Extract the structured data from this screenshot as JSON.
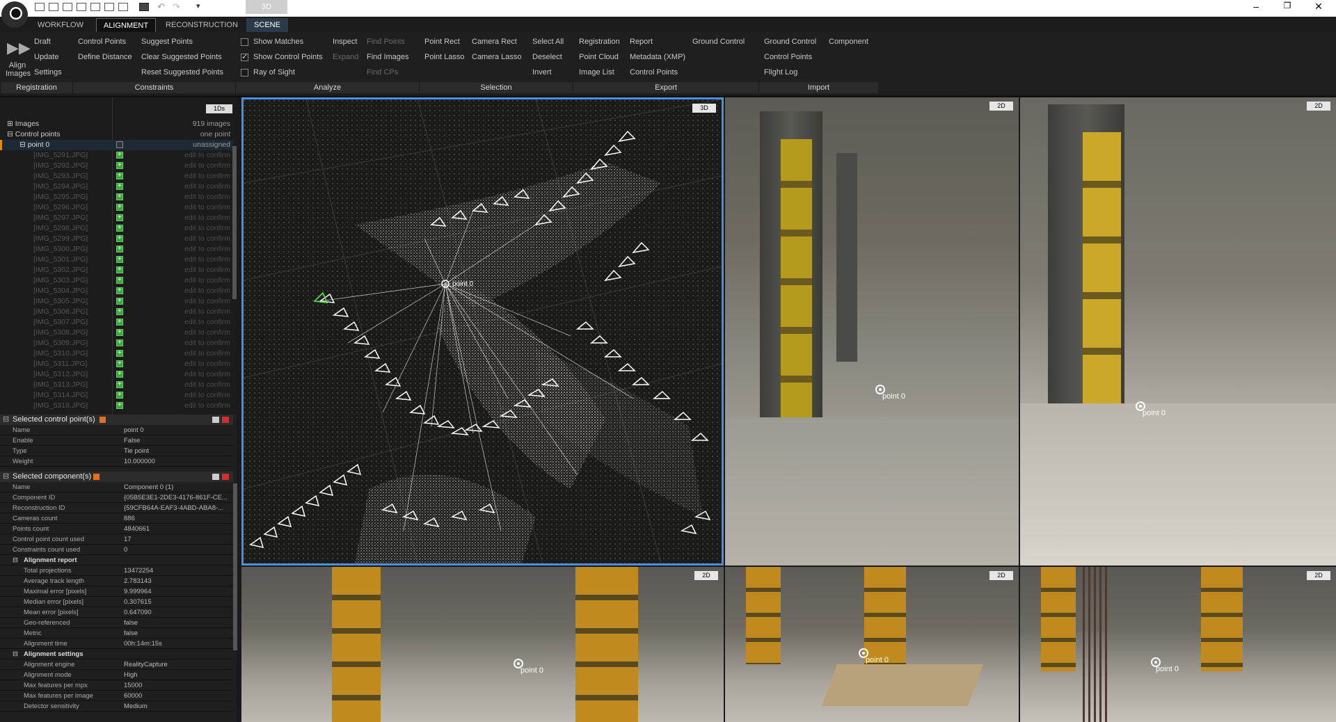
{
  "app": {
    "rc_label": "RC",
    "scene3d_label": "3D"
  },
  "tabs": [
    {
      "label": "WORKFLOW"
    },
    {
      "label": "ALIGNMENT"
    },
    {
      "label": "RECONSTRUCTION"
    },
    {
      "label": "SCENE"
    }
  ],
  "ribbon": {
    "align_images": "Align Images",
    "draft": "Draft",
    "update": "Update",
    "settings": "Settings",
    "control_points": "Control Points",
    "suggest_points": "Suggest Points",
    "define_distance": "Define Distance",
    "clear_suggested": "Clear Suggested Points",
    "reset_suggested": "Reset Suggested Points",
    "show_matches": "Show Matches",
    "show_control_points": "Show Control Points",
    "ray_of_sight": "Ray of Sight",
    "inspect": "Inspect",
    "expand": "Expand",
    "find_points": "Find Points",
    "find_images": "Find Images",
    "find_cps": "Find CPs",
    "point_rect": "Point Rect",
    "point_lasso": "Point Lasso",
    "camera_rect": "Camera Rect",
    "camera_lasso": "Camera Lasso",
    "select_all": "Select All",
    "deselect": "Deselect",
    "invert": "Invert",
    "registration": "Registration",
    "point_cloud": "Point Cloud",
    "image_list": "Image List",
    "report": "Report",
    "metadata": "Metadata (XMP)",
    "control_points_export": "Control Points",
    "ground_control_export": "Ground Control",
    "ground_control_import": "Ground Control",
    "component": "Component",
    "control_points_import": "Control Points",
    "flight_log": "Flight Log",
    "groups": {
      "registration": "Registration",
      "constraints": "Constraints",
      "analyze": "Analyze",
      "selection": "Selection",
      "export": "Export",
      "import": "Import"
    }
  },
  "tree": {
    "tag": "1Ds",
    "images_label": "Images",
    "images_value": "919 images",
    "cp_label": "Control points",
    "cp_value": "one point",
    "point0_label": "point 0",
    "point0_value": "unassigned",
    "edit_text": "edit to confirm",
    "items": [
      "[IMG_5291.JPG]",
      "[IMG_5292.JPG]",
      "[IMG_5293.JPG]",
      "[IMG_5294.JPG]",
      "[IMG_5295.JPG]",
      "[IMG_5296.JPG]",
      "[IMG_5297.JPG]",
      "[IMG_5298.JPG]",
      "[IMG_5299.JPG]",
      "[IMG_5300.JPG]",
      "[IMG_5301.JPG]",
      "[IMG_5302.JPG]",
      "[IMG_5303.JPG]",
      "[IMG_5304.JPG]",
      "[IMG_5305.JPG]",
      "[IMG_5306.JPG]",
      "[IMG_5307.JPG]",
      "[IMG_5308.JPG]",
      "[IMG_5309.JPG]",
      "[IMG_5310.JPG]",
      "[IMG_5311.JPG]",
      "[IMG_5312.JPG]",
      "[IMG_5313.JPG]",
      "[IMG_5314.JPG]",
      "[IMG_5318.JPG]"
    ]
  },
  "selected_cp": {
    "header": "Selected control point(s)",
    "rows": [
      {
        "k": "Name",
        "v": "point 0"
      },
      {
        "k": "Enable",
        "v": "False"
      },
      {
        "k": "Type",
        "v": "Tie point"
      },
      {
        "k": "Weight",
        "v": "10.000000"
      }
    ]
  },
  "selected_comp": {
    "header": "Selected component(s)",
    "rows": [
      {
        "k": "Name",
        "v": "Component 0 (1)"
      },
      {
        "k": "Component ID",
        "v": "{05B5E3E1-2DE3-4176-861F-CE..."
      },
      {
        "k": "Reconstruction ID",
        "v": "{59CFB64A-EAF3-4ABD-ABA8-..."
      },
      {
        "k": "Cameras count",
        "v": "886"
      },
      {
        "k": "Points count",
        "v": "4840661"
      },
      {
        "k": "Control point count used",
        "v": "17"
      },
      {
        "k": "Constraints count used",
        "v": "0"
      }
    ],
    "report_header": "Alignment report",
    "report_rows": [
      {
        "k": "Total projections",
        "v": "13472254"
      },
      {
        "k": "Average track length",
        "v": "2.783143"
      },
      {
        "k": "Maximal error [pixels]",
        "v": "9.999964"
      },
      {
        "k": "Median error [pixels]",
        "v": "0.307615"
      },
      {
        "k": "Mean error [pixels]",
        "v": "0.647090"
      },
      {
        "k": "Geo-referenced",
        "v": "false"
      },
      {
        "k": "Metric",
        "v": "false"
      },
      {
        "k": "Alignment time",
        "v": "00h:14m:15s"
      }
    ],
    "settings_header": "Alignment settings",
    "settings_rows": [
      {
        "k": "Alignment engine",
        "v": "RealityCapture"
      },
      {
        "k": "Alignment mode",
        "v": "High"
      },
      {
        "k": "Max features per mpx",
        "v": "15000"
      },
      {
        "k": "Max features per image",
        "v": "60000"
      },
      {
        "k": "Detector sensitivity",
        "v": "Medium"
      }
    ]
  },
  "views": {
    "tag3d": "3D",
    "tag2d": "2D",
    "point_label": "point 0"
  },
  "colors": {
    "accent": "#4a90e2",
    "check_green": "#3aa83a",
    "warn_red": "#e0302a"
  }
}
